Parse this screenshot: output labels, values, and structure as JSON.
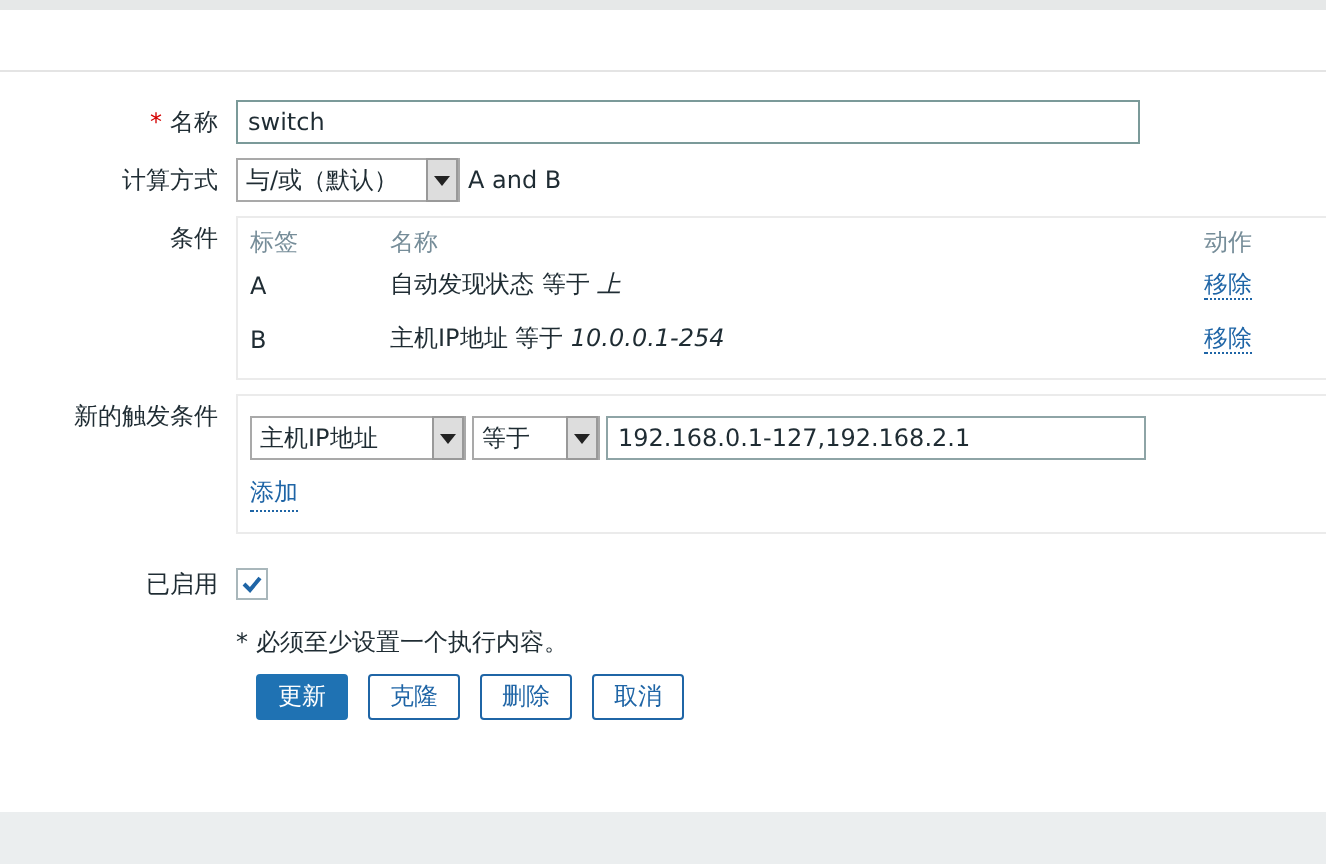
{
  "form": {
    "name": {
      "label": "名称",
      "required_mark": "*",
      "value": "switch"
    },
    "calc": {
      "label": "计算方式",
      "value": "与/或（默认）",
      "formula": "A and B"
    },
    "conditions": {
      "label": "条件",
      "columns": [
        "标签",
        "名称",
        "动作"
      ],
      "rows": [
        {
          "tag": "A",
          "name": "自动发现状态 等于 *上*",
          "action": "移除"
        },
        {
          "tag": "B",
          "name": "主机IP地址 等于 *10.0.0.1-254*",
          "action": "移除"
        }
      ]
    },
    "new_condition": {
      "label": "新的触发条件",
      "type": "主机IP地址",
      "operator": "等于",
      "value": "192.168.0.1-127,192.168.2.1",
      "add": "添加"
    },
    "enabled": {
      "label": "已启用",
      "checked": true
    },
    "note": "* 必须至少设置一个执行内容。",
    "buttons": [
      {
        "label": "更新",
        "kind": "primary"
      },
      {
        "label": "克隆",
        "kind": "secondary"
      },
      {
        "label": "删除",
        "kind": "secondary"
      },
      {
        "label": "取消",
        "kind": "secondary"
      }
    ]
  }
}
